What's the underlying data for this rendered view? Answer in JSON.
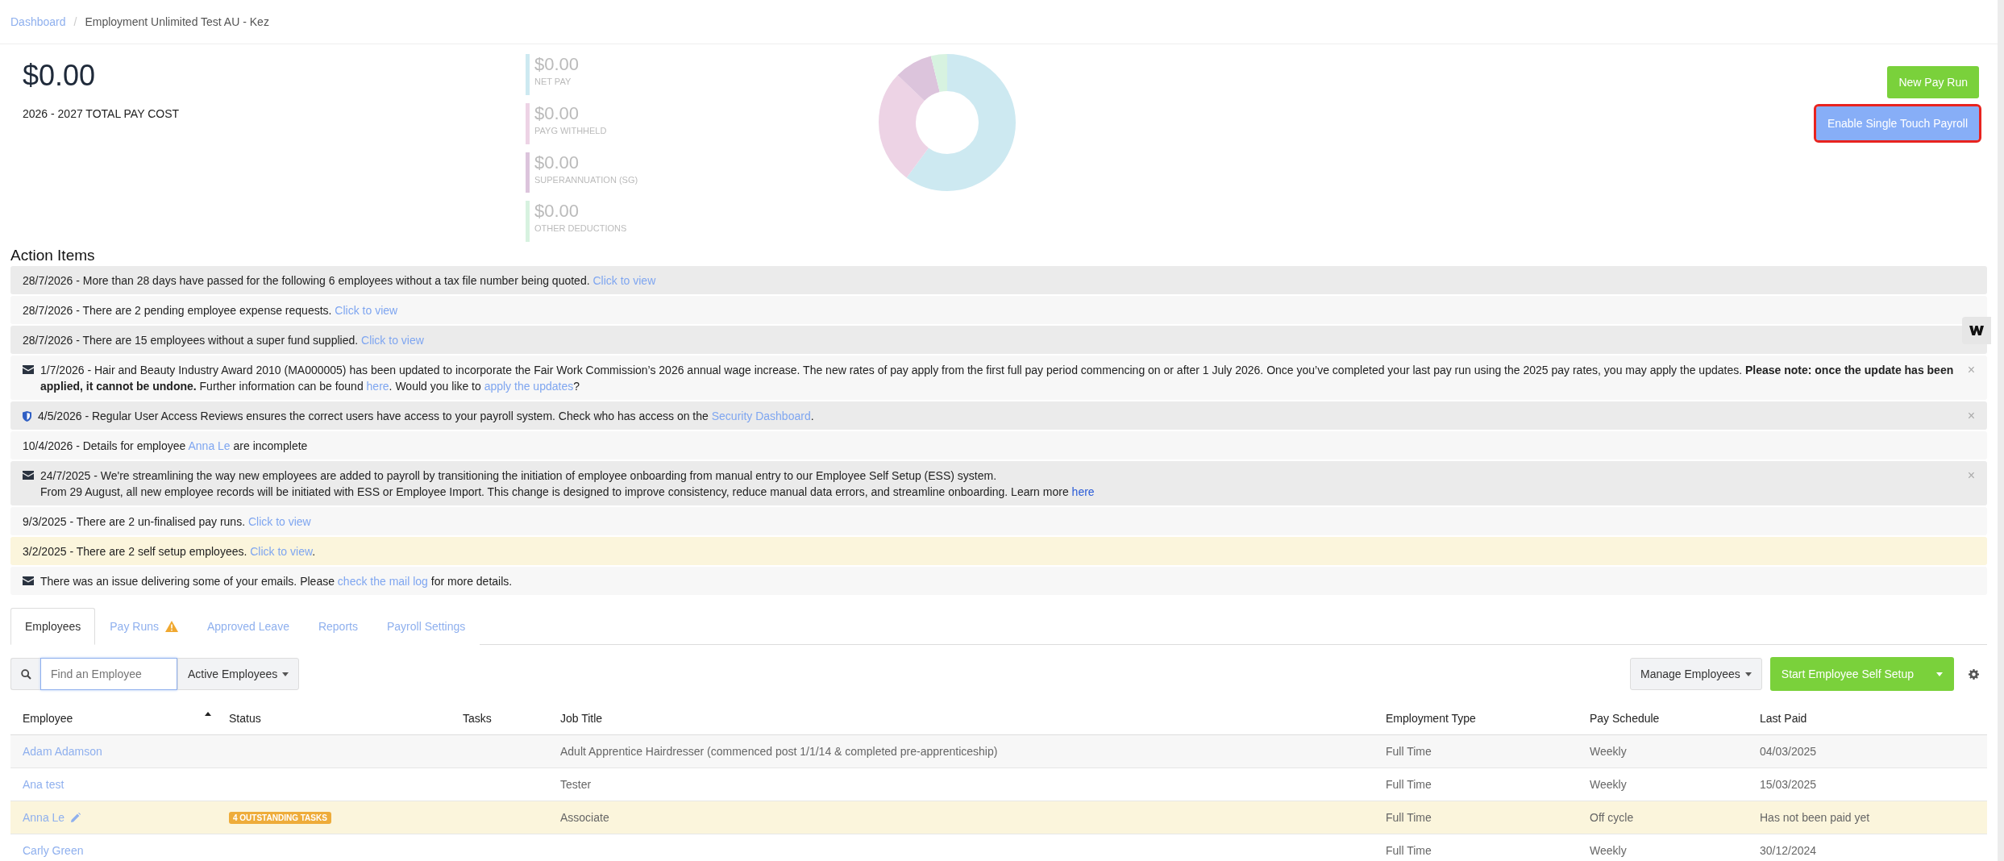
{
  "breadcrumb": {
    "separator": "/",
    "items": [
      {
        "label": "Dashboard",
        "link": true
      },
      {
        "label": "Employment Unlimited Test AU - Kez",
        "link": false
      }
    ]
  },
  "summary": {
    "total": "$0.00",
    "total_label": "2026 - 2027 TOTAL PAY COST",
    "breakdown": [
      {
        "value": "$0.00",
        "label": "NET PAY",
        "color": "#cde9f1"
      },
      {
        "value": "$0.00",
        "label": "PAYG WITHHELD",
        "color": "#edd3e5"
      },
      {
        "value": "$0.00",
        "label": "SUPERANNUATION (SG)",
        "color": "#dcc4dc"
      },
      {
        "value": "$0.00",
        "label": "OTHER DEDUCTIONS",
        "color": "#d7f2e0"
      }
    ]
  },
  "actions": [
    {
      "label": "New Pay Run",
      "kind": "primary",
      "highlighted": false
    },
    {
      "label": "Enable Single Touch Payroll",
      "kind": "secondary",
      "highlighted": true
    }
  ],
  "action_items": {
    "title": "Action Items",
    "items": [
      {
        "kind": "plain",
        "highlighted": false,
        "parts": [
          {
            "kind": "text",
            "text": "28/7/2026 - More than 28 days have passed for the following 6 employees without a tax file number being quoted."
          },
          {
            "kind": "link",
            "text": "Click to view"
          }
        ]
      },
      {
        "kind": "plain",
        "highlighted": false,
        "parts": [
          {
            "kind": "text",
            "text": "28/7/2026 - There are 2 pending employee expense requests."
          },
          {
            "kind": "link",
            "text": "Click to view"
          }
        ]
      },
      {
        "kind": "plain",
        "highlighted": false,
        "parts": [
          {
            "kind": "text",
            "text": "28/7/2026 - There are 15 employees without a super fund supplied."
          },
          {
            "kind": "link",
            "text": "Click to view"
          }
        ]
      },
      {
        "kind": "mail",
        "highlighted": false,
        "close": "×",
        "parts": [
          {
            "kind": "text",
            "text": "1/7/2026 - Hair and Beauty Industry Award 2010 (MA000005) has been updated to incorporate the Fair Work Commission’s 2026 annual wage increase. The new rates of pay apply from the first full pay period commencing on or after 1 July 2026. Once you’ve completed your last pay run using the 2025 pay rates, you may apply the updates. **Please note: once the update has been applied, it cannot be undone.** Further information can be found"
          },
          {
            "kind": "link",
            "text": "here"
          },
          {
            "kind": "text",
            "text": ". Would you like to"
          },
          {
            "kind": "link",
            "text": "apply the updates"
          },
          {
            "kind": "text",
            "text": "?"
          }
        ]
      },
      {
        "kind": "shield",
        "highlighted": false,
        "close": "×",
        "parts": [
          {
            "kind": "text",
            "text": "4/5/2026 - Regular User Access Reviews ensures the correct users have access to your payroll system. Check who has access on the"
          },
          {
            "kind": "link",
            "text": "Security Dashboard"
          },
          {
            "kind": "text",
            "text": "."
          }
        ]
      },
      {
        "kind": "plain",
        "highlighted": false,
        "parts": [
          {
            "kind": "text",
            "text": "10/4/2026 - Details for employee"
          },
          {
            "kind": "link",
            "text": "Anna Le"
          },
          {
            "kind": "text",
            "text": "are incomplete"
          }
        ]
      },
      {
        "kind": "mail",
        "highlighted": false,
        "close": "×",
        "parts": [
          {
            "kind": "text",
            "text": "24/7/2025 - We're streamlining the way new employees are added to payroll by transitioning the initiation of employee onboarding from manual entry to our Employee Self Setup (ESS) system."
          },
          {
            "kind": "break",
            "text": "From 29 August, all new employee records will be initiated with ESS or Employee Import. This change is designed to improve consistency, reduce manual data errors, and streamline onboarding. Learn more"
          },
          {
            "kind": "strong-link",
            "text": "here"
          }
        ]
      },
      {
        "kind": "plain",
        "highlighted": false,
        "parts": [
          {
            "kind": "text",
            "text": "9/3/2025 - There are 2 un-finalised pay runs."
          },
          {
            "kind": "link",
            "text": "Click to view"
          }
        ]
      },
      {
        "kind": "plain",
        "highlighted": true,
        "parts": [
          {
            "kind": "text",
            "text": "3/2/2025 - There are 2 self setup employees."
          },
          {
            "kind": "link",
            "text": "Click to view"
          },
          {
            "kind": "text",
            "text": "."
          }
        ]
      },
      {
        "kind": "mail",
        "highlighted": false,
        "parts": [
          {
            "kind": "text",
            "text": "There was an issue delivering some of your emails. Please"
          },
          {
            "kind": "link",
            "text": "check the mail log"
          },
          {
            "kind": "text",
            "text": "for more details."
          }
        ]
      }
    ]
  },
  "tabs": [
    {
      "label": "Employees",
      "selected": true,
      "warning": false
    },
    {
      "label": "Pay Runs",
      "selected": false,
      "warning": true
    },
    {
      "label": "Approved Leave",
      "selected": false,
      "warning": false
    },
    {
      "label": "Reports",
      "selected": false,
      "warning": false
    },
    {
      "label": "Payroll Settings",
      "selected": false,
      "warning": false
    }
  ],
  "toolbar": {
    "search_placeholder": "Find an Employee",
    "filter": "Active Employees",
    "manage": "Manage Employees",
    "start": "Start Employee Self Setup"
  },
  "table": {
    "columns": [
      {
        "label": "Employee",
        "sorted": true
      },
      {
        "label": "Status",
        "sorted": false
      },
      {
        "label": "Tasks",
        "sorted": false
      },
      {
        "label": "Job Title",
        "sorted": false
      },
      {
        "label": "Employment Type",
        "sorted": false
      },
      {
        "label": "Pay Schedule",
        "sorted": false
      },
      {
        "label": "Last Paid",
        "sorted": false
      }
    ],
    "rows": [
      {
        "name": "Adam Adamson",
        "editable": false,
        "highlighted": false,
        "job_title": "Adult Apprentice Hairdresser (commenced post 1/1/14 & completed pre-apprenticeship)",
        "employment_type": "Full Time",
        "pay_schedule": "Weekly",
        "last_paid": "04/03/2025"
      },
      {
        "name": "Ana test",
        "editable": false,
        "highlighted": false,
        "job_title": "Tester",
        "employment_type": "Full Time",
        "pay_schedule": "Weekly",
        "last_paid": "15/03/2025"
      },
      {
        "name": "Anna Le",
        "editable": true,
        "highlighted": true,
        "status": "4 OUTSTANDING TASKS",
        "job_title": "Associate",
        "employment_type": "Full Time",
        "pay_schedule": "Off cycle",
        "last_paid": "Has not been paid yet"
      },
      {
        "name": "Carly Green",
        "editable": false,
        "highlighted": false,
        "employment_type": "Full Time",
        "pay_schedule": "Weekly",
        "last_paid": "30/12/2024"
      }
    ]
  }
}
